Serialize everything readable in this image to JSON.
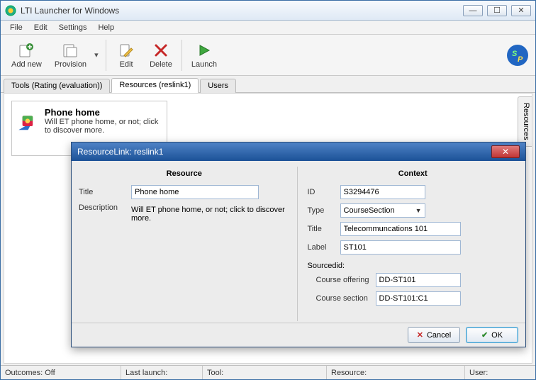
{
  "window": {
    "title": "LTI Launcher for Windows"
  },
  "menus": {
    "file": "File",
    "edit": "Edit",
    "settings": "Settings",
    "help": "Help"
  },
  "toolbar": {
    "add_new": "Add new",
    "provision": "Provision",
    "edit": "Edit",
    "delete": "Delete",
    "launch": "Launch"
  },
  "tabs": {
    "tools": "Tools (Rating (evaluation))",
    "resources": "Resources (reslink1)",
    "users": "Users"
  },
  "side_tab": "Resources",
  "card": {
    "title": "Phone home",
    "desc": "Will ET phone home, or not; click to discover more."
  },
  "statusbar": {
    "outcomes": "Outcomes: Off",
    "last_launch": "Last launch:",
    "tool": "Tool:",
    "resource": "Resource:",
    "user": "User:"
  },
  "dialog": {
    "title": "ResourceLink: reslink1",
    "resource_heading": "Resource",
    "context_heading": "Context",
    "labels": {
      "title": "Title",
      "description": "Description",
      "id": "ID",
      "type": "Type",
      "ctx_title": "Title",
      "label": "Label",
      "sourcedid": "Sourcedid:",
      "course_offering": "Course offering",
      "course_section": "Course section"
    },
    "values": {
      "title": "Phone home",
      "description": "Will ET phone home, or not; click to discover more.",
      "id": "S3294476",
      "type": "CourseSection",
      "ctx_title": "Telecommuncations 101",
      "label": "ST101",
      "course_offering": "DD-ST101",
      "course_section": "DD-ST101:C1"
    },
    "buttons": {
      "cancel": "Cancel",
      "ok": "OK"
    }
  }
}
